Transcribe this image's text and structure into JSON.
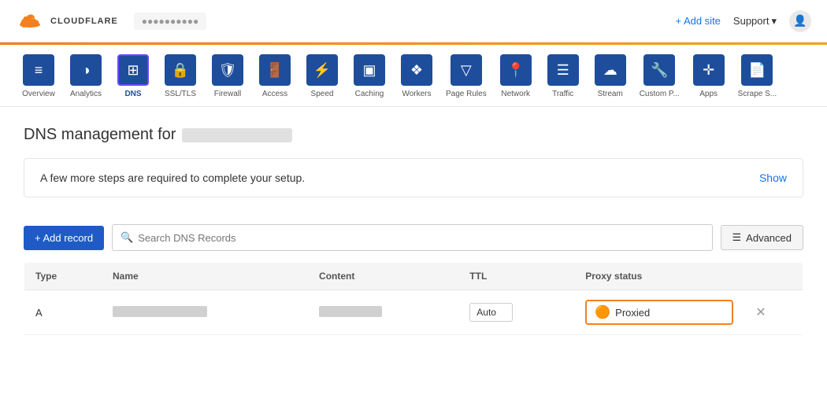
{
  "header": {
    "logo_text": "CLOUDFLARE",
    "domain_label": "●●●●●●●●●●",
    "add_site_label": "+ Add site",
    "support_label": "Support",
    "chevron": "▾"
  },
  "orange_bar": true,
  "nav": {
    "items": [
      {
        "id": "overview",
        "label": "Overview",
        "icon": "≡",
        "active": false
      },
      {
        "id": "analytics",
        "label": "Analytics",
        "icon": "◑",
        "active": false
      },
      {
        "id": "dns",
        "label": "DNS",
        "icon": "⊞",
        "active": true
      },
      {
        "id": "ssl-tls",
        "label": "SSL/TLS",
        "icon": "🔒",
        "active": false
      },
      {
        "id": "firewall",
        "label": "Firewall",
        "icon": "🛡",
        "active": false
      },
      {
        "id": "access",
        "label": "Access",
        "icon": "🚪",
        "active": false
      },
      {
        "id": "speed",
        "label": "Speed",
        "icon": "⚡",
        "active": false
      },
      {
        "id": "caching",
        "label": "Caching",
        "icon": "▣",
        "active": false
      },
      {
        "id": "workers",
        "label": "Workers",
        "icon": "◈",
        "active": false
      },
      {
        "id": "page-rules",
        "label": "Page Rules",
        "icon": "▽",
        "active": false
      },
      {
        "id": "network",
        "label": "Network",
        "icon": "📍",
        "active": false
      },
      {
        "id": "traffic",
        "label": "Traffic",
        "icon": "☰",
        "active": false
      },
      {
        "id": "stream",
        "label": "Stream",
        "icon": "☁",
        "active": false
      },
      {
        "id": "custom-pages",
        "label": "Custom P...",
        "icon": "🔧",
        "active": false
      },
      {
        "id": "apps",
        "label": "Apps",
        "icon": "✛",
        "active": false
      },
      {
        "id": "scrape-shield",
        "label": "Scrape S...",
        "icon": "📄",
        "active": false
      }
    ]
  },
  "main": {
    "page_title": "DNS management for",
    "setup_banner": {
      "text": "A few more steps are required to complete your setup.",
      "show_label": "Show"
    },
    "toolbar": {
      "add_record_label": "+ Add record",
      "search_placeholder": "Search DNS Records",
      "advanced_label": "Advanced"
    },
    "table": {
      "columns": [
        "Type",
        "Name",
        "Content",
        "TTL",
        "Proxy status",
        ""
      ],
      "rows": [
        {
          "type": "A",
          "name_blur_width": "120",
          "content_blur_width": "80",
          "ttl": "Auto",
          "proxy_status": "Proxied"
        }
      ]
    }
  }
}
